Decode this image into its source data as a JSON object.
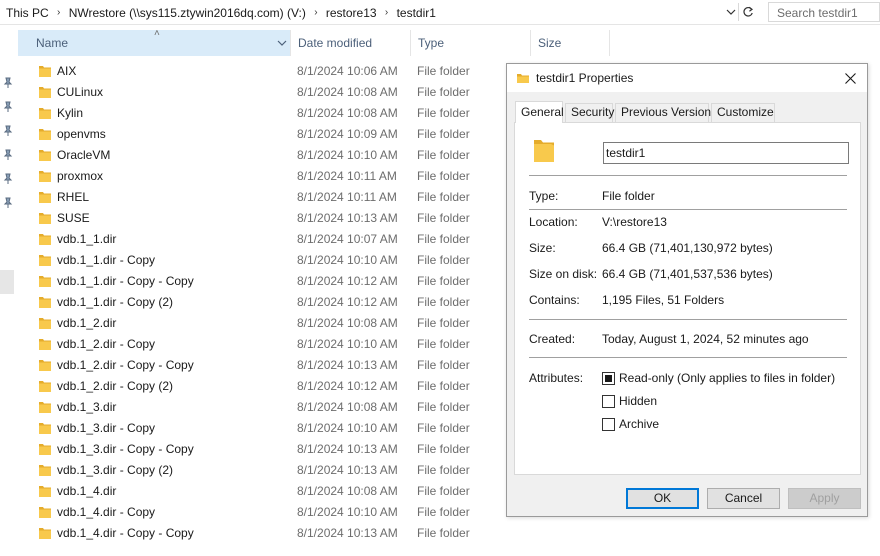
{
  "address": {
    "crumbs": [
      "This PC",
      "NWrestore (\\\\sys115.ztywin2016dq.com) (V:)",
      "restore13",
      "testdir1"
    ],
    "search_placeholder": "Search testdir1"
  },
  "columns": {
    "name": "Name",
    "date": "Date modified",
    "type": "Type",
    "size": "Size"
  },
  "files": [
    {
      "name": "AIX",
      "date": "8/1/2024 10:06 AM",
      "type": "File folder"
    },
    {
      "name": "CULinux",
      "date": "8/1/2024 10:08 AM",
      "type": "File folder"
    },
    {
      "name": "Kylin",
      "date": "8/1/2024 10:08 AM",
      "type": "File folder"
    },
    {
      "name": "openvms",
      "date": "8/1/2024 10:09 AM",
      "type": "File folder"
    },
    {
      "name": "OracleVM",
      "date": "8/1/2024 10:10 AM",
      "type": "File folder"
    },
    {
      "name": "proxmox",
      "date": "8/1/2024 10:11 AM",
      "type": "File folder"
    },
    {
      "name": "RHEL",
      "date": "8/1/2024 10:11 AM",
      "type": "File folder"
    },
    {
      "name": "SUSE",
      "date": "8/1/2024 10:13 AM",
      "type": "File folder"
    },
    {
      "name": "vdb.1_1.dir",
      "date": "8/1/2024 10:07 AM",
      "type": "File folder"
    },
    {
      "name": "vdb.1_1.dir - Copy",
      "date": "8/1/2024 10:10 AM",
      "type": "File folder"
    },
    {
      "name": "vdb.1_1.dir - Copy - Copy",
      "date": "8/1/2024 10:12 AM",
      "type": "File folder"
    },
    {
      "name": "vdb.1_1.dir - Copy (2)",
      "date": "8/1/2024 10:12 AM",
      "type": "File folder"
    },
    {
      "name": "vdb.1_2.dir",
      "date": "8/1/2024 10:08 AM",
      "type": "File folder"
    },
    {
      "name": "vdb.1_2.dir - Copy",
      "date": "8/1/2024 10:10 AM",
      "type": "File folder"
    },
    {
      "name": "vdb.1_2.dir - Copy - Copy",
      "date": "8/1/2024 10:13 AM",
      "type": "File folder"
    },
    {
      "name": "vdb.1_2.dir - Copy (2)",
      "date": "8/1/2024 10:12 AM",
      "type": "File folder"
    },
    {
      "name": "vdb.1_3.dir",
      "date": "8/1/2024 10:08 AM",
      "type": "File folder"
    },
    {
      "name": "vdb.1_3.dir - Copy",
      "date": "8/1/2024 10:10 AM",
      "type": "File folder"
    },
    {
      "name": "vdb.1_3.dir - Copy - Copy",
      "date": "8/1/2024 10:13 AM",
      "type": "File folder"
    },
    {
      "name": "vdb.1_3.dir - Copy (2)",
      "date": "8/1/2024 10:13 AM",
      "type": "File folder"
    },
    {
      "name": "vdb.1_4.dir",
      "date": "8/1/2024 10:08 AM",
      "type": "File folder"
    },
    {
      "name": "vdb.1_4.dir - Copy",
      "date": "8/1/2024 10:10 AM",
      "type": "File folder"
    },
    {
      "name": "vdb.1_4.dir - Copy - Copy",
      "date": "8/1/2024 10:13 AM",
      "type": "File folder"
    }
  ],
  "dialog": {
    "title": "testdir1 Properties",
    "tabs": [
      "General",
      "Security",
      "Previous Versions",
      "Customize"
    ],
    "folder_name": "testdir1",
    "props": {
      "type_label": "Type:",
      "type_value": "File folder",
      "location_label": "Location:",
      "location_value": "V:\\restore13",
      "size_label": "Size:",
      "size_value": "66.4 GB (71,401,130,972 bytes)",
      "size_on_disk_label": "Size on disk:",
      "size_on_disk_value": "66.4 GB (71,401,537,536 bytes)",
      "contains_label": "Contains:",
      "contains_value": "1,195 Files, 51 Folders",
      "created_label": "Created:",
      "created_value": "Today, August 1, 2024, 52 minutes ago",
      "attributes_label": "Attributes:"
    },
    "attributes": {
      "readonly": "Read-only (Only applies to files in folder)",
      "hidden": "Hidden",
      "archive": "Archive"
    },
    "buttons": {
      "ok": "OK",
      "cancel": "Cancel",
      "apply": "Apply"
    }
  },
  "colors": {
    "folder": "#f8c94c",
    "folder_dark": "#e5ac2b",
    "accent": "#0078d7",
    "header_selected": "#d9ebf9"
  }
}
